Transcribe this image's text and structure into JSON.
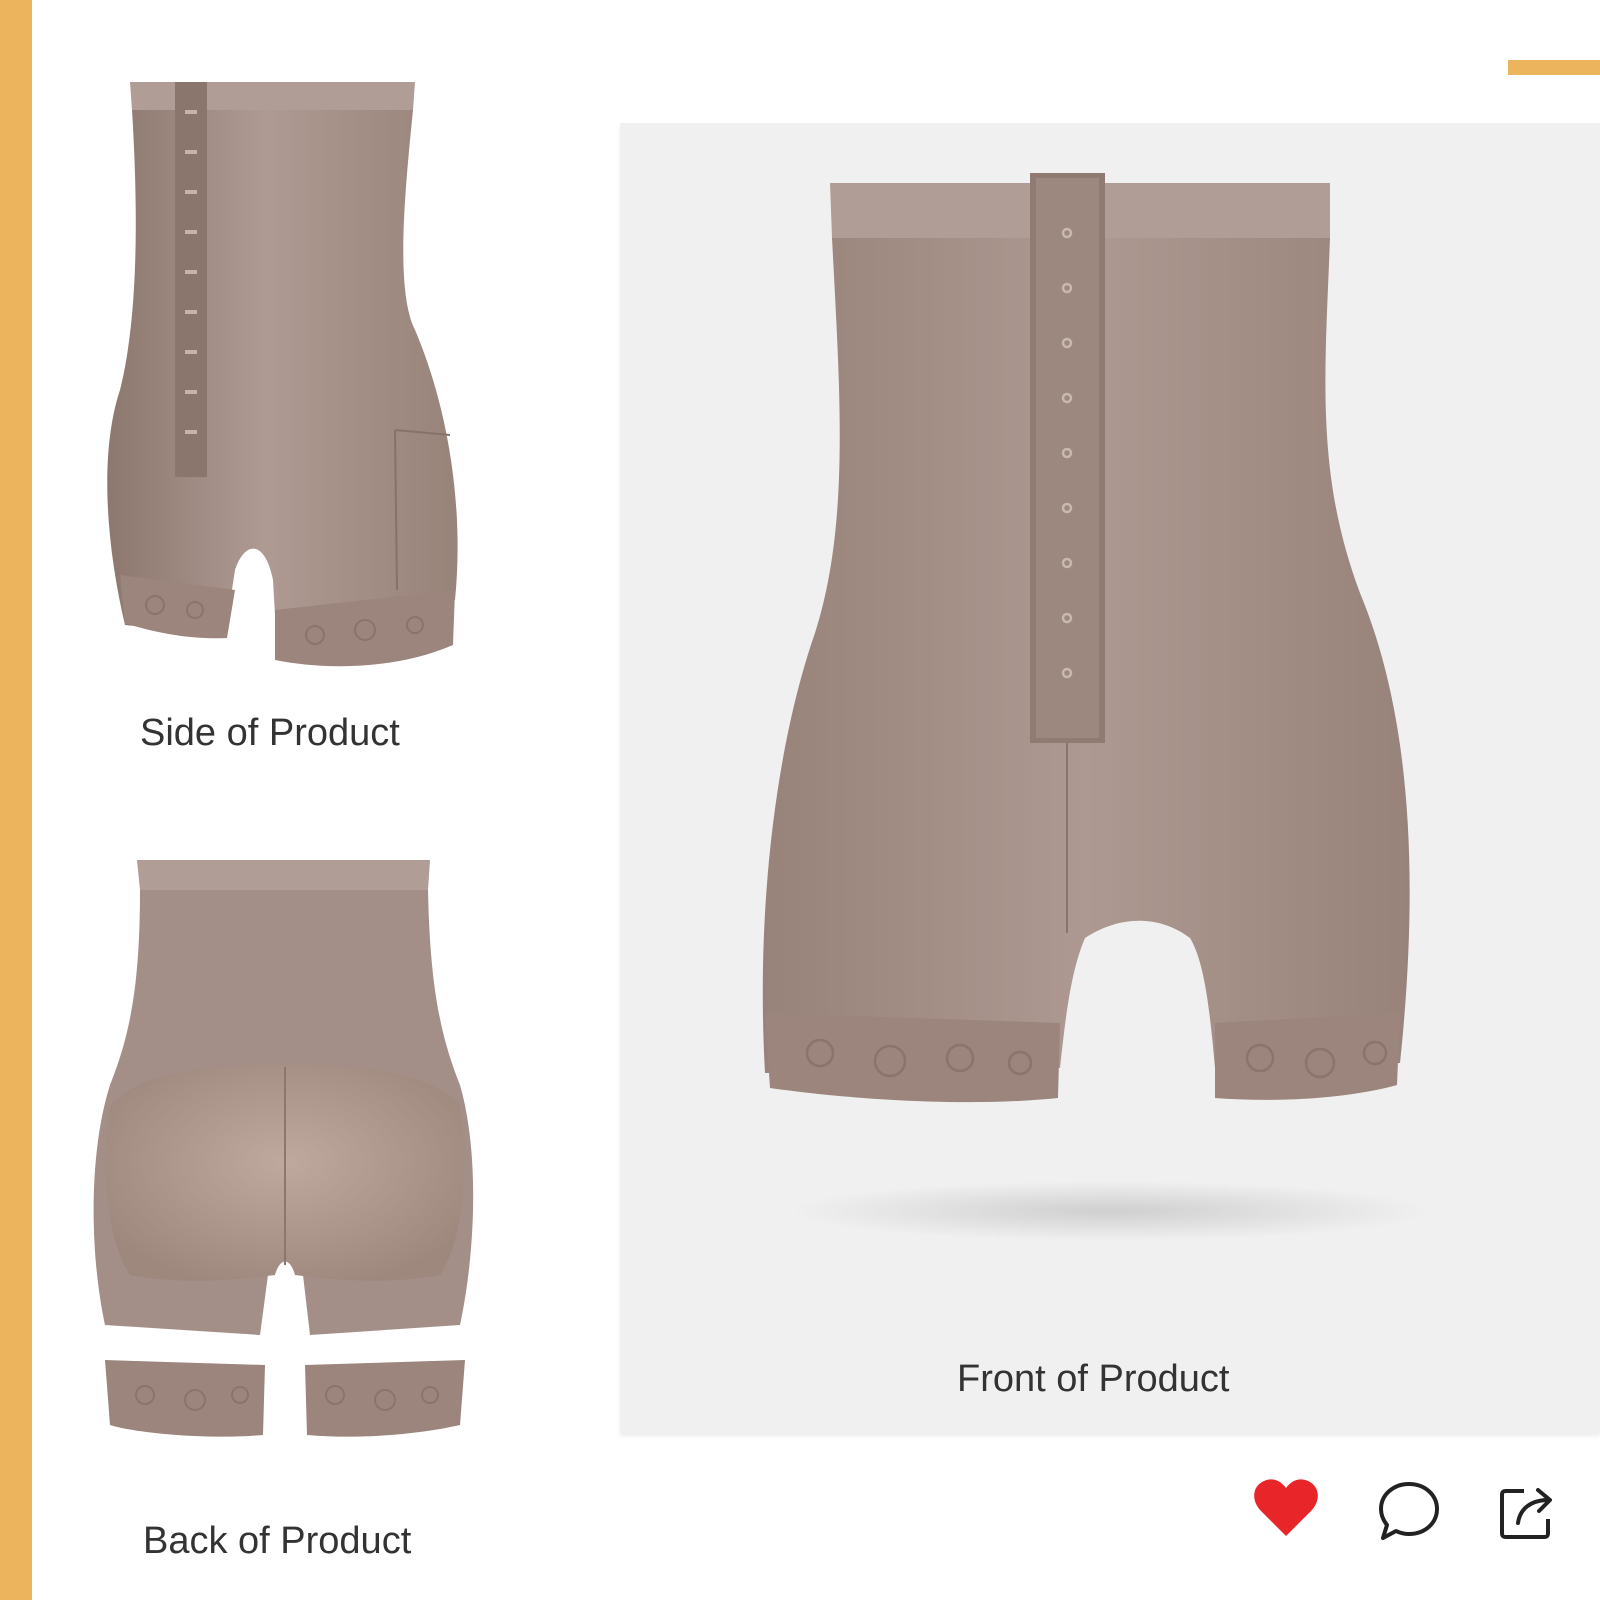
{
  "colors": {
    "accent": "#ecb45c",
    "like_red": "#e8262a",
    "fabric": "#a38f87",
    "fabric_light": "#b4a199",
    "fabric_dark": "#8c786f",
    "lace": "#9b857c",
    "caption": "#333333"
  },
  "gallery": {
    "side_caption": "Side of Product",
    "back_caption": "Back of Product",
    "front_caption": "Front of Product"
  },
  "actions": {
    "like_icon": "heart-icon",
    "comment_icon": "comment-bubble-icon",
    "share_icon": "share-icon",
    "liked": true
  }
}
